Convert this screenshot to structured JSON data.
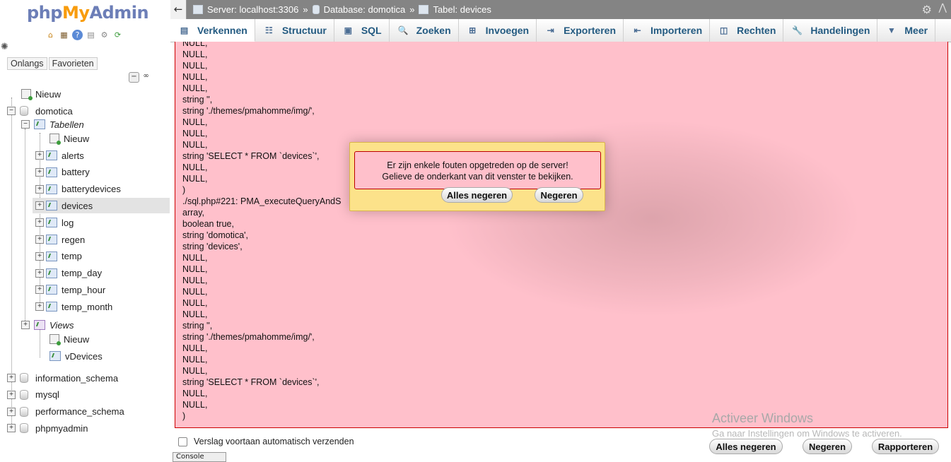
{
  "logo": {
    "part1": "php",
    "part2": "My",
    "part3": "Admin"
  },
  "nav": {
    "tabs": [
      "Onlangs",
      "Favorieten"
    ],
    "tree": {
      "new": "Nieuw",
      "db_domotica": "domotica",
      "tables_label": "Tabellen",
      "tables_new": "Nieuw",
      "tables": [
        "alerts",
        "battery",
        "batterydevices",
        "devices",
        "log",
        "regen",
        "temp",
        "temp_day",
        "temp_hour",
        "temp_month"
      ],
      "selected_table": "devices",
      "views_label": "Views",
      "views_new": "Nieuw",
      "views": [
        "vDevices"
      ],
      "other_dbs": [
        "information_schema",
        "mysql",
        "performance_schema",
        "phpmyadmin"
      ]
    }
  },
  "topbar": {
    "server": "Server: localhost:3306",
    "database": "Database: domotica",
    "table": "Tabel: devices"
  },
  "menu": {
    "tabs": [
      {
        "label": "Verkennen",
        "icon": "table-icon"
      },
      {
        "label": "Structuur",
        "icon": "structure-icon"
      },
      {
        "label": "SQL",
        "icon": "sql-icon"
      },
      {
        "label": "Zoeken",
        "icon": "search-icon"
      },
      {
        "label": "Invoegen",
        "icon": "insert-icon"
      },
      {
        "label": "Exporteren",
        "icon": "export-icon"
      },
      {
        "label": "Importeren",
        "icon": "import-icon"
      },
      {
        "label": "Rechten",
        "icon": "privileges-icon"
      },
      {
        "label": "Handelingen",
        "icon": "wrench-icon"
      },
      {
        "label": "Meer",
        "icon": "chevron-down-icon"
      }
    ],
    "active": "Verkennen"
  },
  "trace": {
    "lines": [
      "NULL,",
      "NULL,",
      "NULL,",
      "NULL,",
      "NULL,",
      "string '',",
      "string './themes/pmahomme/img/',",
      "NULL,",
      "NULL,",
      "NULL,",
      "string 'SELECT * FROM `devices`',",
      "NULL,",
      "NULL,",
      ")",
      "./sql.php#221: PMA_executeQueryAndS",
      "array,",
      "boolean true,",
      "string 'domotica',",
      "string 'devices',",
      "NULL,",
      "NULL,",
      "NULL,",
      "NULL,",
      "NULL,",
      "NULL,",
      "string '',",
      "string './themes/pmahomme/img/',",
      "NULL,",
      "NULL,",
      "NULL,",
      "string 'SELECT * FROM `devices`',",
      "NULL,",
      "NULL,",
      ")"
    ]
  },
  "dialog": {
    "line1": "Er zijn enkele fouten opgetreden op de server!",
    "line2": "Gelieve de onderkant van dit venster te bekijken.",
    "ignore_all": "Alles negeren",
    "ignore": "Negeren"
  },
  "footer": {
    "auto_send_label": "Verslag voortaan automatisch verzenden",
    "ignore_all": "Alles negeren",
    "ignore": "Negeren",
    "report": "Rapporteren"
  },
  "watermark": {
    "title": "Activeer Windows",
    "subtitle": "Ga naar Instellingen om Windows te activeren."
  },
  "console": {
    "label": "Console"
  },
  "colors": {
    "error_bg": "#ffc0cb",
    "dialog_bg": "#fce28a",
    "tab_text": "#235a81",
    "topbar": "#848484"
  }
}
